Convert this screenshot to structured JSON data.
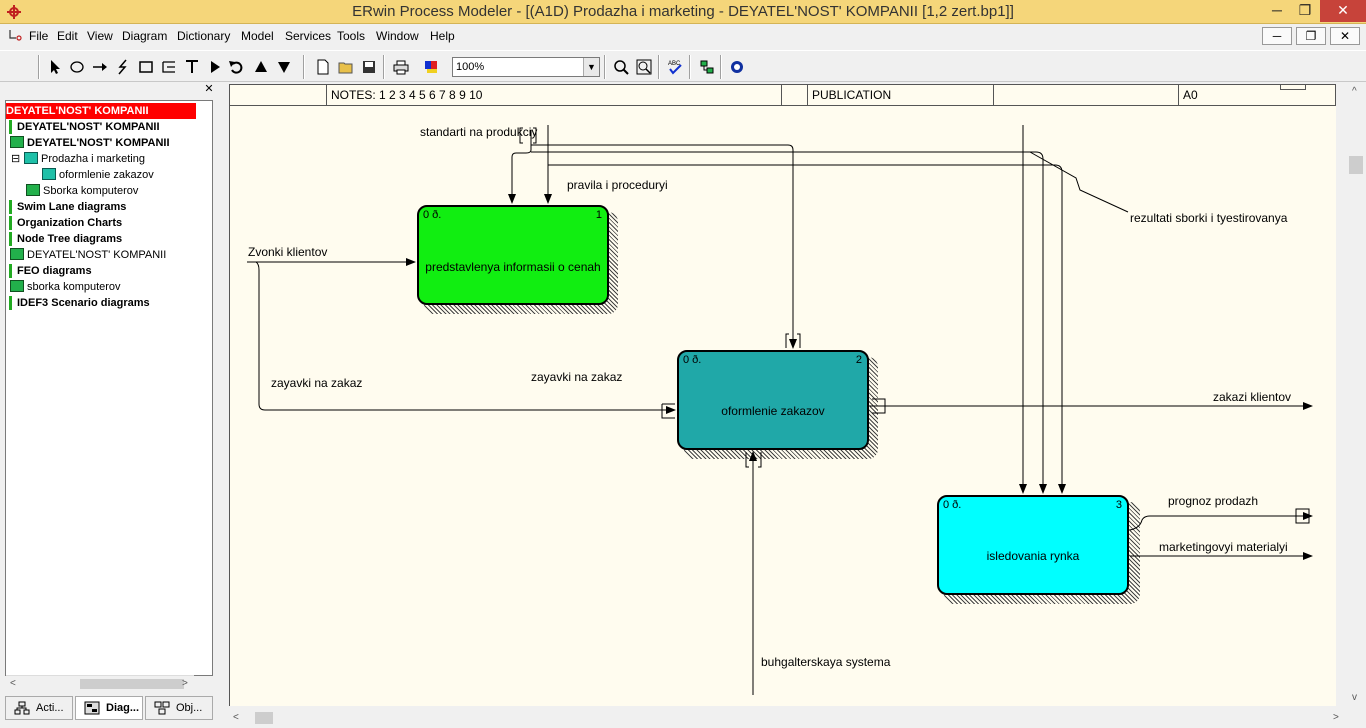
{
  "window": {
    "title": "ERwin Process Modeler - [(A1D) Prodazha i marketing - DEYATEL'NOST' KOMPANII  [1,2 zert.bp1]]",
    "minimize": "─",
    "maximize": "❐",
    "close": "✕"
  },
  "menu": {
    "items": [
      "File",
      "Edit",
      "View",
      "Diagram",
      "Dictionary",
      "Model",
      "Services",
      "Tools",
      "Window",
      "Help"
    ],
    "mdi_min": "─",
    "mdi_restore": "❐",
    "mdi_close": "✕"
  },
  "toolbar": {
    "zoom": "100%"
  },
  "tree": {
    "items": [
      "DEYATEL'NOST' KOMPANII",
      "DEYATEL'NOST' KOMPANII",
      "DEYATEL'NOST' KOMPANII",
      "Prodazha i marketing",
      "oformlenie zakazov",
      "Sborka komputerov",
      "Swim Lane diagrams",
      "Organization Charts",
      "Node Tree diagrams",
      "DEYATEL'NOST' KOMPANII",
      "FEO diagrams",
      "sborka komputerov",
      "IDEF3 Scenario diagrams"
    ],
    "expander": "⊟",
    "panel_close": "✕"
  },
  "tabs": [
    "Acti...",
    "Diag...",
    "Obj..."
  ],
  "diagram": {
    "header": {
      "notes": "NOTES:  1  2  3  4  5  6  7  8  9  10",
      "publication": "PUBLICATION",
      "node": "A0"
    },
    "boxes": [
      {
        "label": "predstavlenya informasii o cenah",
        "num_left": "0 ð.",
        "num_right": "1",
        "color": "#11ee11"
      },
      {
        "label": "oformlenie zakazov",
        "num_left": "0 ð.",
        "num_right": "2",
        "color": "#20a8a8"
      },
      {
        "label": "isledovania rynka",
        "num_left": "0 ð.",
        "num_right": "3",
        "color": "#00ffff"
      }
    ],
    "arrows": {
      "standarti": "standarti na produkciy",
      "pravila": "pravila i proceduryi",
      "rezultati": "rezultati sborki i tyestirovanya",
      "zvonki": "Zvonki klientov",
      "zayavki_left": "zayavki na zakaz",
      "zayavki_mid": "zayavki na zakaz",
      "zakazi": "zakazi klientov",
      "prognoz": "prognoz prodazh",
      "marketing": "marketingovyi materialyi",
      "buhgalter": "buhgalterskaya systema"
    }
  }
}
